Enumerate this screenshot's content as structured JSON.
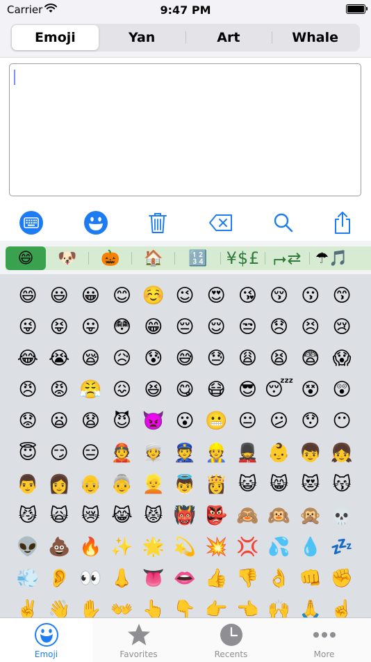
{
  "status": {
    "carrier": "Carrier",
    "time": "9:47 PM"
  },
  "segments": [
    {
      "label": "Emoji",
      "selected": true
    },
    {
      "label": "Yan",
      "selected": false
    },
    {
      "label": "Art",
      "selected": false
    },
    {
      "label": "Whale",
      "selected": false
    }
  ],
  "editor": {
    "value": ""
  },
  "toolbar": [
    "keyboard-icon",
    "smiley-icon",
    "trash-icon",
    "delete-backward-icon",
    "search-icon",
    "share-icon"
  ],
  "categories": [
    {
      "glyph": "😄",
      "name": "smileys",
      "selected": true
    },
    {
      "glyph": "🐶",
      "name": "animals",
      "selected": false
    },
    {
      "glyph": "🎃",
      "name": "objects",
      "selected": false
    },
    {
      "glyph": "🏠",
      "name": "places",
      "selected": false
    },
    {
      "glyph": "🔢",
      "name": "symbols",
      "selected": false
    },
    {
      "glyph": "¥$£",
      "name": "currency",
      "selected": false,
      "text": true
    },
    {
      "glyph": "⮣⇄",
      "name": "arrows",
      "selected": false,
      "text": true
    },
    {
      "glyph": "☂🎵",
      "name": "misc",
      "selected": false
    }
  ],
  "emojis": [
    [
      "😄",
      "😃",
      "😀",
      "😊",
      "☺️",
      "😉",
      "😍",
      "😘",
      "😚",
      "😗",
      "😙"
    ],
    [
      "😜",
      "😝",
      "😛",
      "😳",
      "😁",
      "😔",
      "😌",
      "😒",
      "😞",
      "😣",
      "😢"
    ],
    [
      "😂",
      "😭",
      "😪",
      "😥",
      "😰",
      "😅",
      "😓",
      "😩",
      "😫",
      "😨",
      "😱"
    ],
    [
      "😠",
      "😡",
      "😤",
      "😖",
      "😆",
      "😋",
      "😷",
      "😎",
      "😴",
      "😵",
      "😲"
    ],
    [
      "😟",
      "😦",
      "😧",
      "😈",
      "👿",
      "😮",
      "😬",
      "😐",
      "😕",
      "😯",
      "😶"
    ],
    [
      "😇",
      "😏",
      "😑",
      "👲",
      "👳",
      "👮",
      "👷",
      "💂",
      "👶",
      "👦",
      "👧"
    ],
    [
      "👨",
      "👩",
      "👴",
      "👵",
      "👱",
      "👼",
      "👸",
      "😺",
      "😸",
      "😻",
      "😽"
    ],
    [
      "😼",
      "🙀",
      "😿",
      "😹",
      "😾",
      "👹",
      "👺",
      "🙈",
      "🙉",
      "🙊",
      "💀"
    ],
    [
      "👽",
      "💩",
      "🔥",
      "✨",
      "🌟",
      "💫",
      "💥",
      "💢",
      "💦",
      "💧",
      "💤"
    ],
    [
      "💨",
      "👂",
      "👀",
      "👃",
      "👅",
      "👄",
      "👍",
      "👎",
      "👌",
      "👊",
      "✊"
    ],
    [
      "✌️",
      "👋",
      "✋",
      "👐",
      "👆",
      "👇",
      "👉",
      "👈",
      "🙌",
      "🙏",
      "☝️"
    ]
  ],
  "tabs": [
    {
      "label": "Emoji",
      "icon": "emoji-face-icon",
      "active": true
    },
    {
      "label": "Favorites",
      "icon": "star-icon",
      "active": false
    },
    {
      "label": "Recents",
      "icon": "clock-icon",
      "active": false
    },
    {
      "label": "More",
      "icon": "more-dots-icon",
      "active": false
    }
  ],
  "colors": {
    "accent": "#1d7cf2",
    "category_selected": "#3aa24f",
    "category_bar": "#d7ebd3"
  }
}
